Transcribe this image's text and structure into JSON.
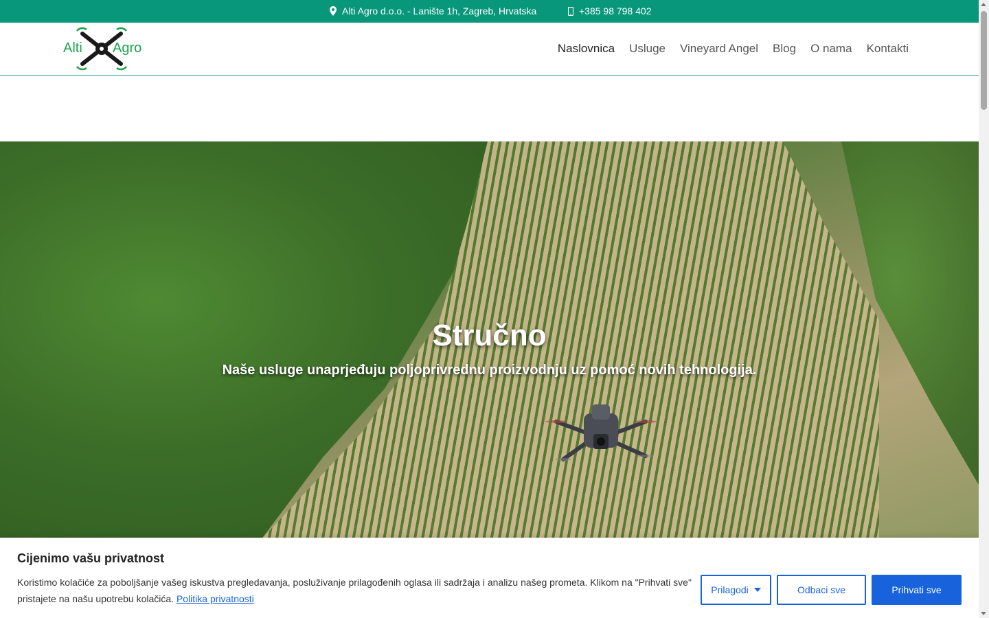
{
  "topbar": {
    "address": "Alti Agro d.o.o. - Lanište 1h, Zagreb, Hrvatska",
    "phone": "+385 98 798 402",
    "address_icon": "map-pin-icon",
    "phone_icon": "mobile-phone-icon",
    "color": "#08977a"
  },
  "logo": {
    "left_text": "Alti",
    "right_text": "Agro"
  },
  "nav": {
    "items": [
      {
        "label": "Naslovnica",
        "active": true
      },
      {
        "label": "Usluge"
      },
      {
        "label": "Vineyard Angel"
      },
      {
        "label": "Blog"
      },
      {
        "label": "O nama"
      },
      {
        "label": "Kontakti"
      }
    ]
  },
  "hero": {
    "title": "Stručno",
    "subtitle": "Naše usluge unaprjeđuju poljoprivrednu proizvodnju uz pomoć novih tehnologija."
  },
  "cookie": {
    "title": "Cijenimo vašu privatnost",
    "text": "Koristimo kolačiće za poboljšanje vašeg iskustva pregledavanja, posluživanje prilagođenih oglasa ili sadržaja i analizu našeg prometa. Klikom na \"Prihvati sve\" pristajete na našu upotrebu kolačića.",
    "link": "Politika privatnosti",
    "customize_label": "Prilagodi",
    "reject_label": "Odbaci sve",
    "accept_label": "Prihvati sve",
    "accent": "#1863dc"
  }
}
